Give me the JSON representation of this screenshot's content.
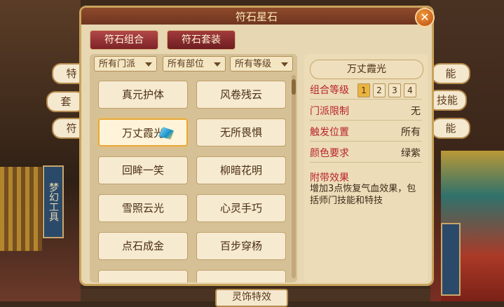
{
  "window": {
    "title": "符石星石"
  },
  "tabs": [
    {
      "label": "符石组合",
      "active": true
    },
    {
      "label": "符石套装",
      "active": false
    }
  ],
  "filters": [
    "所有门派",
    "所有部位",
    "所有等级"
  ],
  "items": [
    {
      "name": "真元护体"
    },
    {
      "name": "风卷残云"
    },
    {
      "name": "万丈霞光",
      "selected": true
    },
    {
      "name": "无所畏惧"
    },
    {
      "name": "回眸一笑"
    },
    {
      "name": "柳暗花明"
    },
    {
      "name": "雪照云光"
    },
    {
      "name": "心灵手巧"
    },
    {
      "name": "点石成金"
    },
    {
      "name": "百步穿杨"
    }
  ],
  "detail": {
    "title": "万丈霞光",
    "combo_level_label": "组合等级",
    "levels": [
      "1",
      "2",
      "3",
      "4"
    ],
    "sect_label": "门派限制",
    "sect_value": "无",
    "trigger_label": "触发位置",
    "trigger_value": "所有",
    "color_label": "颜色要求",
    "color_value": "绿紫",
    "effect_label": "附带效果",
    "effect_text": "增加3点恢复气血效果，包括师门技能和特技"
  },
  "background": {
    "side_tags": [
      "特",
      "套",
      "符",
      "梦幻工具"
    ],
    "right_tags": [
      "能",
      "技能",
      "能"
    ],
    "bottom_button": "灵饰特效"
  },
  "colors": {
    "accent_red": "#b8242a",
    "panel_bg": "#e7d7b2",
    "tab_red": "#a23a3a"
  }
}
